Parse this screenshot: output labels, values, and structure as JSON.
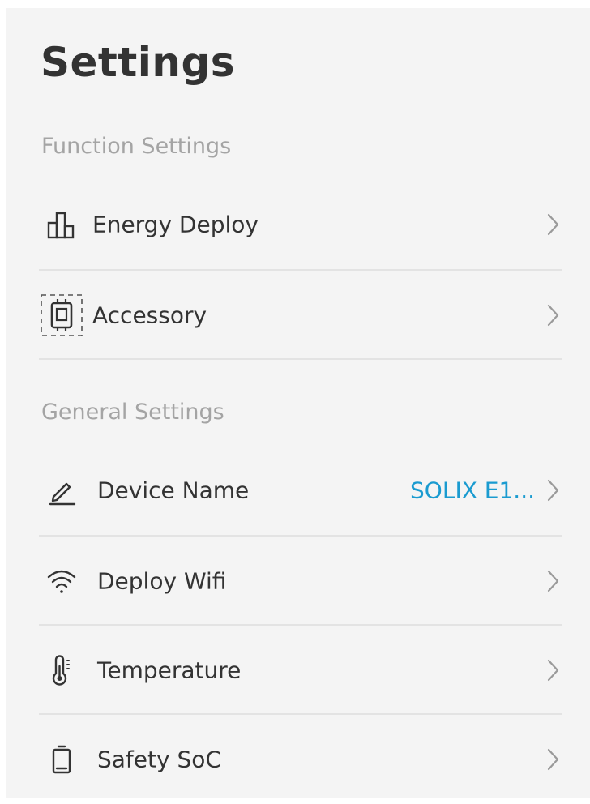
{
  "page": {
    "title": "Settings"
  },
  "colors": {
    "background": "#f4f4f4",
    "text": "#333333",
    "section_label": "#a4a4a4",
    "accent": "#1a9bd0",
    "divider": "#e3e3e3"
  },
  "function_settings": {
    "label": "Function Settings",
    "items": [
      {
        "label": "Energy Deploy",
        "icon": "bar-chart-icon"
      },
      {
        "label": "Accessory",
        "icon": "accessory-device-icon"
      }
    ]
  },
  "general_settings": {
    "label": "General Settings",
    "items": [
      {
        "label": "Device Name",
        "icon": "pencil-icon",
        "value": "SOLIX E1..."
      },
      {
        "label": "Deploy Wifi",
        "icon": "wifi-icon"
      },
      {
        "label": "Temperature",
        "icon": "thermometer-icon"
      },
      {
        "label": "Safety SoC",
        "icon": "battery-icon"
      }
    ]
  }
}
